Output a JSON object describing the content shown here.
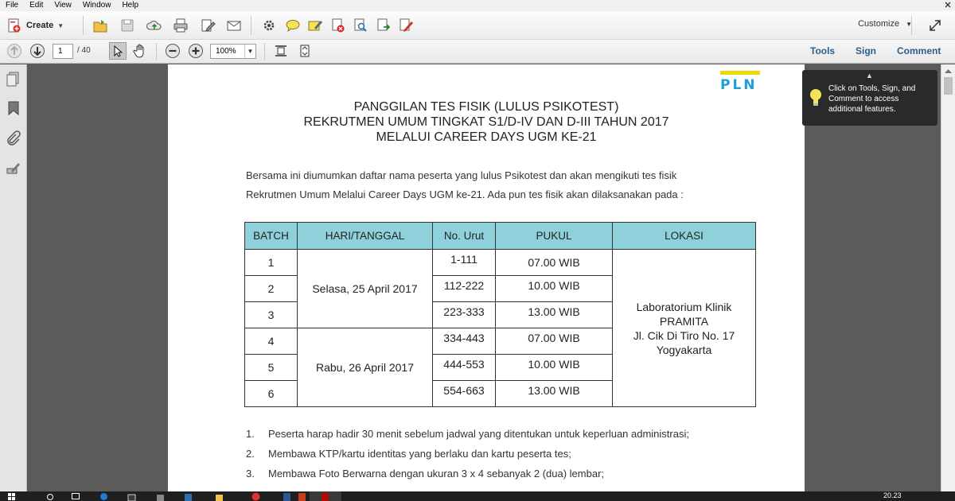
{
  "menu": [
    "File",
    "Edit",
    "View",
    "Window",
    "Help"
  ],
  "toolbar": {
    "create_label": "Create",
    "customize_label": "Customize",
    "page_current": "1",
    "page_total": "/ 40",
    "zoom": "100%",
    "tools_label": "Tools",
    "sign_label": "Sign",
    "comment_label": "Comment"
  },
  "tooltip": {
    "text": "Click on Tools, Sign, and Comment to access additional features."
  },
  "document": {
    "logo_text": "PLN",
    "title_lines": [
      "PANGGILAN TES FISIK (LULUS PSIKOTEST)",
      "REKRUTMEN UMUM TINGKAT S1/D-IV DAN D-III TAHUN 2017",
      "MELALUI CAREER DAYS UGM KE-21"
    ],
    "intro_lines": [
      "Bersama ini diumumkan daftar nama peserta yang lulus Psikotest dan akan mengikuti tes fisik",
      "Rekrutmen Umum Melalui Career Days UGM ke-21. Ada pun tes fisik akan dilaksanakan pada :"
    ],
    "table": {
      "headers": [
        "BATCH",
        "HARI/TANGGAL",
        "No. Urut",
        "PUKUL",
        "LOKASI"
      ],
      "batches": [
        {
          "batch": "1",
          "no": "1-111",
          "pukul": "07.00 WIB"
        },
        {
          "batch": "2",
          "no": "112-222",
          "pukul": "10.00 WIB"
        },
        {
          "batch": "3",
          "no": "223-333",
          "pukul": "13.00 WIB"
        },
        {
          "batch": "4",
          "no": "334-443",
          "pukul": "07.00 WIB"
        },
        {
          "batch": "5",
          "no": "444-553",
          "pukul": "10.00 WIB"
        },
        {
          "batch": "6",
          "no": "554-663",
          "pukul": "13.00 WIB"
        }
      ],
      "dates": [
        "Selasa, 25 April 2017",
        "Rabu, 26 April 2017"
      ],
      "lokasi_lines": [
        "Laboratorium Klinik",
        "PRAMITA",
        "Jl. Cik Di Tiro No. 17",
        "Yogyakarta"
      ]
    },
    "notes": [
      {
        "num": "1.",
        "text": "Peserta harap hadir 30 menit sebelum jadwal yang ditentukan untuk keperluan administrasi;"
      },
      {
        "num": "2.",
        "text": "Membawa KTP/kartu identitas yang berlaku dan kartu peserta tes;"
      },
      {
        "num": "3.",
        "text": "Membawa Foto Berwarna dengan ukuran 3 x 4 sebanyak 2 (dua) lembar;"
      }
    ]
  },
  "taskbar": {
    "clock": "20.23"
  }
}
